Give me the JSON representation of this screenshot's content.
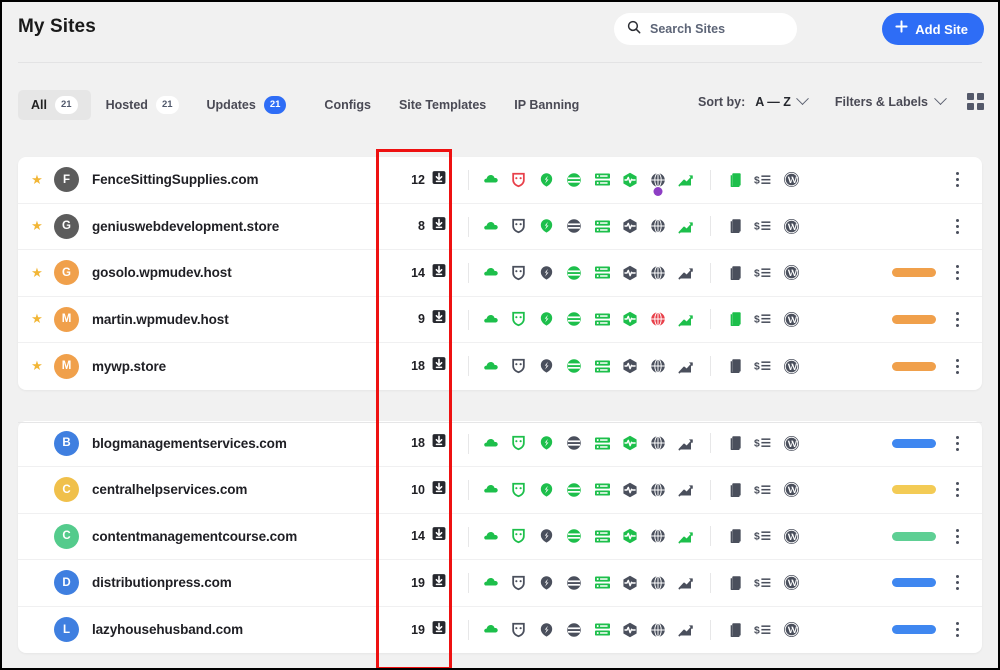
{
  "header": {
    "title": "My Sites",
    "search": {
      "placeholder": "Search Sites",
      "icon": "search-icon"
    },
    "add_site": {
      "label": "Add Site",
      "icon": "plus-icon",
      "color": "#2e6df6"
    }
  },
  "toolbar": {
    "tabs": [
      {
        "label": "All",
        "count": "21",
        "active": true,
        "badge_style": "light"
      },
      {
        "label": "Hosted",
        "count": "21",
        "active": false,
        "badge_style": "light"
      },
      {
        "label": "Updates",
        "count": "21",
        "active": false,
        "badge_style": "blue"
      },
      {
        "label": "Configs",
        "count": "",
        "active": false,
        "badge_style": "none"
      },
      {
        "label": "Site Templates",
        "count": "",
        "active": false,
        "badge_style": "none"
      },
      {
        "label": "IP Banning",
        "count": "",
        "active": false,
        "badge_style": "none"
      }
    ],
    "sort_by_label": "Sort by:",
    "sort_by_value": "A — Z",
    "filters_label": "Filters & Labels",
    "grid_view_icon": "grid-view-icon"
  },
  "icon_columns": [
    "cloud-icon",
    "defender-shield-icon",
    "hummingbird-icon",
    "smush-icon",
    "hosting-server-icon",
    "uptime-icon",
    "seo-globe-icon",
    "analytics-chart-icon",
    "blog-pages-icon",
    "billing-icon",
    "wordpress-icon"
  ],
  "legend_colors": {
    "active_green": "#1dbf4b",
    "inactive_gray": "#4a4f5c",
    "alert_red": "#e8404a",
    "badge_purple": "#8d3ec4"
  },
  "groups": [
    {
      "name": "favorites",
      "rows": [
        {
          "starred": true,
          "avatar_letter": "F",
          "avatar_color": "#5c5c5c",
          "name": "FenceSittingSupplies.com",
          "updates": "12",
          "icon_states": [
            "green",
            "red",
            "green",
            "green",
            "green",
            "green",
            "dark",
            "green",
            "green",
            "dark",
            "dark"
          ],
          "badge_dot": {
            "index": 6,
            "color": "#8d3ec4"
          },
          "label_color": ""
        },
        {
          "starred": true,
          "avatar_letter": "G",
          "avatar_color": "#5c5c5c",
          "name": "geniuswebdevelopment.store",
          "updates": "8",
          "icon_states": [
            "green",
            "dark",
            "green",
            "dark",
            "green",
            "dark",
            "dark",
            "green",
            "dark",
            "dark",
            "dark"
          ],
          "badge_dot": null,
          "label_color": ""
        },
        {
          "starred": true,
          "avatar_letter": "G",
          "avatar_color": "#f0a04b",
          "name": "gosolo.wpmudev.host",
          "updates": "14",
          "icon_states": [
            "green",
            "dark",
            "dark",
            "green",
            "green",
            "dark",
            "dark",
            "dark",
            "dark",
            "dark",
            "dark"
          ],
          "badge_dot": null,
          "label_color": "#f0a04b"
        },
        {
          "starred": true,
          "avatar_letter": "M",
          "avatar_color": "#f0a04b",
          "name": "martin.wpmudev.host",
          "updates": "9",
          "icon_states": [
            "green",
            "green",
            "green",
            "green",
            "green",
            "green",
            "red",
            "green",
            "green",
            "dark",
            "dark"
          ],
          "badge_dot": null,
          "label_color": "#f0a04b"
        },
        {
          "starred": true,
          "avatar_letter": "M",
          "avatar_color": "#f0a04b",
          "name": "mywp.store",
          "updates": "18",
          "icon_states": [
            "green",
            "dark",
            "dark",
            "green",
            "green",
            "dark",
            "dark",
            "dark",
            "dark",
            "dark",
            "dark"
          ],
          "badge_dot": null,
          "label_color": "#f0a04b"
        }
      ]
    },
    {
      "name": "all-sites",
      "rows": [
        {
          "starred": false,
          "avatar_letter": "B",
          "avatar_color": "#3f7fe0",
          "name": "blogmanagementservices.com",
          "updates": "18",
          "icon_states": [
            "green",
            "green",
            "green",
            "dark",
            "green",
            "green",
            "dark",
            "dark",
            "dark",
            "dark",
            "dark"
          ],
          "badge_dot": null,
          "label_color": "#3f87f0"
        },
        {
          "starred": false,
          "avatar_letter": "C",
          "avatar_color": "#f0c04b",
          "name": "centralhelpservices.com",
          "updates": "10",
          "icon_states": [
            "green",
            "green",
            "green",
            "green",
            "green",
            "dark",
            "dark",
            "dark",
            "dark",
            "dark",
            "dark"
          ],
          "badge_dot": null,
          "label_color": "#f3cb55"
        },
        {
          "starred": false,
          "avatar_letter": "C",
          "avatar_color": "#54cb8c",
          "name": "contentmanagementcourse.com",
          "updates": "14",
          "icon_states": [
            "green",
            "green",
            "dark",
            "green",
            "green",
            "green",
            "dark",
            "green",
            "dark",
            "dark",
            "dark"
          ],
          "badge_dot": null,
          "label_color": "#5ecf94"
        },
        {
          "starred": false,
          "avatar_letter": "D",
          "avatar_color": "#3f7fe0",
          "name": "distributionpress.com",
          "updates": "19",
          "icon_states": [
            "green",
            "dark",
            "dark",
            "dark",
            "green",
            "dark",
            "dark",
            "dark",
            "dark",
            "dark",
            "dark"
          ],
          "badge_dot": null,
          "label_color": "#3f87f0"
        },
        {
          "starred": false,
          "avatar_letter": "L",
          "avatar_color": "#3f7fe0",
          "name": "lazyhousehusband.com",
          "updates": "19",
          "icon_states": [
            "green",
            "dark",
            "dark",
            "dark",
            "green",
            "dark",
            "dark",
            "dark",
            "dark",
            "dark",
            "dark"
          ],
          "badge_dot": null,
          "label_color": "#3f87f0"
        }
      ]
    }
  ],
  "annotation": {
    "name": "updates-column-highlight",
    "color": "#ee1111"
  }
}
